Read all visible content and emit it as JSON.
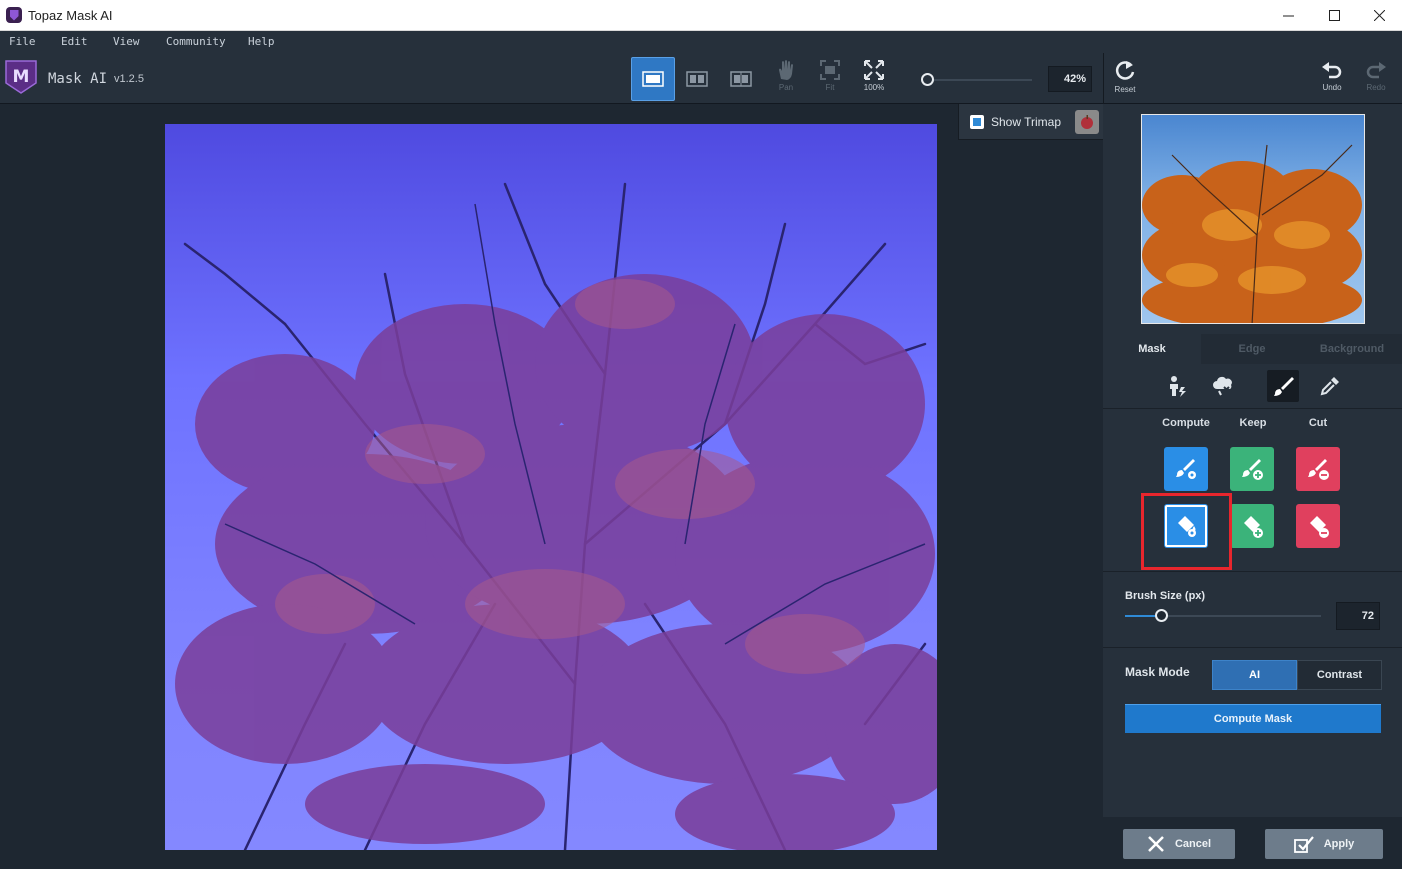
{
  "window": {
    "title": "Topaz Mask AI",
    "controls": [
      "minimize",
      "maximize",
      "close"
    ]
  },
  "menu": [
    "File",
    "Edit",
    "View",
    "Community",
    "Help"
  ],
  "toolbar": {
    "app_name": "Mask AI",
    "version": "v1.2.5",
    "view_modes": [
      "single-view-icon",
      "split-view-icon",
      "side-by-side-view-icon"
    ],
    "active_view": 0,
    "pan_label": "Pan",
    "fit_label": "Fit",
    "zoom100_label": "100%",
    "zoom_value": "42%",
    "reset_label": "Reset",
    "undo_label": "Undo",
    "redo_label": "Redo"
  },
  "canvas": {
    "show_trimap_label": "Show Trimap",
    "show_trimap_checked": true
  },
  "panel": {
    "tabs": [
      "Mask",
      "Edge",
      "Background"
    ],
    "active_tab": "Mask",
    "tools": [
      "select-subject-icon",
      "cloud-tool-icon",
      "brush-tool-icon",
      "color-picker-icon"
    ],
    "active_tool": "brush-tool-icon",
    "columns": [
      "Compute",
      "Keep",
      "Cut"
    ],
    "brushes": [
      {
        "type": "brush",
        "mode": "compute",
        "color": "#2a8ee6"
      },
      {
        "type": "brush",
        "mode": "keep",
        "color": "#3bb37a"
      },
      {
        "type": "brush",
        "mode": "cut",
        "color": "#e0405e"
      },
      {
        "type": "fill",
        "mode": "compute",
        "color": "#2a8ee6",
        "selected": true
      },
      {
        "type": "fill",
        "mode": "keep",
        "color": "#3bb37a"
      },
      {
        "type": "fill",
        "mode": "cut",
        "color": "#e0405e"
      }
    ],
    "brush_size_label": "Brush Size (px)",
    "brush_size_value": "72",
    "mask_mode_label": "Mask Mode",
    "mask_modes": [
      "AI",
      "Contrast"
    ],
    "active_mask_mode": "AI",
    "compute_mask_label": "Compute Mask",
    "cancel_label": "Cancel",
    "apply_label": "Apply"
  },
  "colors": {
    "accent": "#2f78c4",
    "highlight": "#e8262d",
    "background": "#1e2731",
    "panel": "#26303b"
  }
}
